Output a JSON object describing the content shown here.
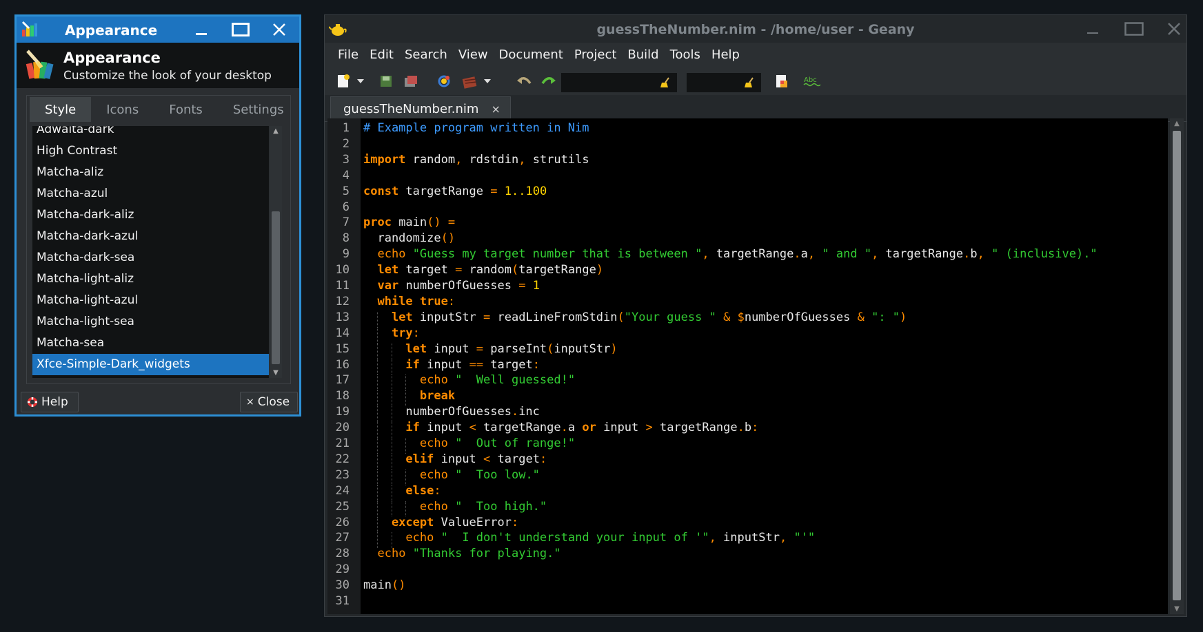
{
  "appearance": {
    "title": "Appearance",
    "header_title": "Appearance",
    "header_subtitle": "Customize the look of your desktop",
    "tabs": [
      "Style",
      "Icons",
      "Fonts",
      "Settings"
    ],
    "active_tab": "Style",
    "themes": [
      "Adwaita-dark",
      "High Contrast",
      "Matcha-aliz",
      "Matcha-azul",
      "Matcha-dark-aliz",
      "Matcha-dark-azul",
      "Matcha-dark-sea",
      "Matcha-light-aliz",
      "Matcha-light-azul",
      "Matcha-light-sea",
      "Matcha-sea",
      "Xfce-Simple-Dark_widgets"
    ],
    "selected_theme": "Xfce-Simple-Dark_widgets",
    "help_label": "Help",
    "close_label": "Close"
  },
  "geany": {
    "title": "guessTheNumber.nim - /home/user - Geany",
    "menu": [
      "File",
      "Edit",
      "Search",
      "View",
      "Document",
      "Project",
      "Build",
      "Tools",
      "Help"
    ],
    "search_value": "",
    "goto_value": "",
    "tab_name": "guessTheNumber.nim",
    "code_lines": [
      "# Example program written in Nim",
      "",
      "import random, rdstdin, strutils",
      "",
      "const targetRange = 1..100",
      "",
      "proc main() =",
      "  randomize()",
      "  echo \"Guess my target number that is between \", targetRange.a, \" and \", targetRange.b, \" (inclusive).\"",
      "  let target = random(targetRange)",
      "  var numberOfGuesses = 1",
      "  while true:",
      "    let inputStr = readLineFromStdin(\"Your guess \" & $numberOfGuesses & \": \")",
      "    try:",
      "      let input = parseInt(inputStr)",
      "      if input == target:",
      "        echo \"  Well guessed!\"",
      "        break",
      "      numberOfGuesses.inc",
      "      if input < targetRange.a or input > targetRange.b:",
      "        echo \"  Out of range!\"",
      "      elif input < target:",
      "        echo \"  Too low.\"",
      "      else:",
      "        echo \"  Too high.\"",
      "    except ValueError:",
      "      echo \"  I don't understand your input of '\", inputStr, \"'\"",
      "  echo \"Thanks for playing.\"",
      "",
      "main()",
      ""
    ]
  }
}
